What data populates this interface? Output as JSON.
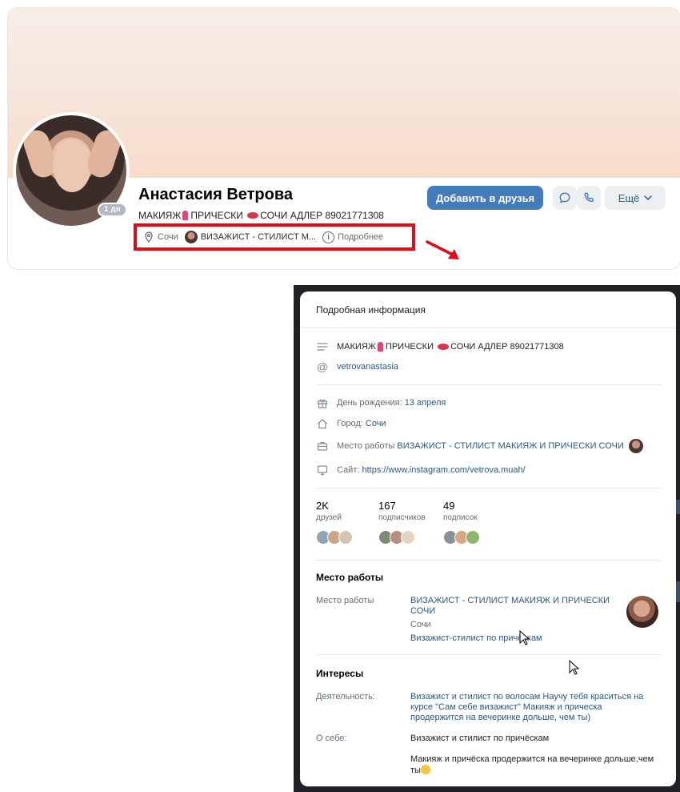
{
  "profile": {
    "name": "Анастасия Ветрова",
    "status_before": "МАКИЯЖ",
    "status_mid": "ПРИЧЕСКИ",
    "status_after": "СОЧИ АДЛЕР 89021771308",
    "online": "1 дн",
    "info_city": "Сочи",
    "info_job": "ВИЗАЖИСТ - СТИЛИСТ М...",
    "info_more": "Подробнее"
  },
  "actions": {
    "add_friend": "Добавить в друзья",
    "more": "Ещё"
  },
  "modal": {
    "title": "Подробная информация",
    "status_before": "МАКИЯЖ",
    "status_mid": "ПРИЧЕСКИ",
    "status_after": "СОЧИ АДЛЕР 89021771308",
    "nickname": "vetrovanastasia",
    "birthday_label": "День рождения:",
    "birthday_value": "13 апреля",
    "city_label": "Город:",
    "city_value": "Сочи",
    "work_label": "Место работы",
    "work_value": "ВИЗАЖИСТ - СТИЛИСТ МАКИЯЖ И ПРИЧЕСКИ СОЧИ",
    "site_label": "Сайт:",
    "site_value": "https://www.instagram.com/vetrova.muah/",
    "stats": [
      {
        "num": "2K",
        "cap": "друзей"
      },
      {
        "num": "167",
        "cap": "подписчиков"
      },
      {
        "num": "49",
        "cap": "подписок"
      }
    ],
    "work_section_title": "Место работы",
    "work_section_label": "Место работы",
    "work_section_name": "ВИЗАЖИСТ - СТИЛИСТ МАКИЯЖ И ПРИЧЕСКИ СОЧИ",
    "work_section_city": "Сочи",
    "work_section_role": "Визажист-стилист по причёскам",
    "interests_title": "Интересы",
    "activity_label": "Деятельность:",
    "activity_value": "Визажист и стилист по волосам Научу тебя краситься на курсе \"Сам себе визажист\" Макияж и прическа продержится на вечеринке дольше, чем ты)",
    "about_label": "О себе:",
    "about_value_1": "Визажист и стилист по причёскам",
    "about_value_2": "Макияж и причёска продержится на вечеринке дольше,чем ты"
  },
  "colors": {
    "accent": "#447bba",
    "highlight": "#e00a1a",
    "link": "#2a5885"
  }
}
